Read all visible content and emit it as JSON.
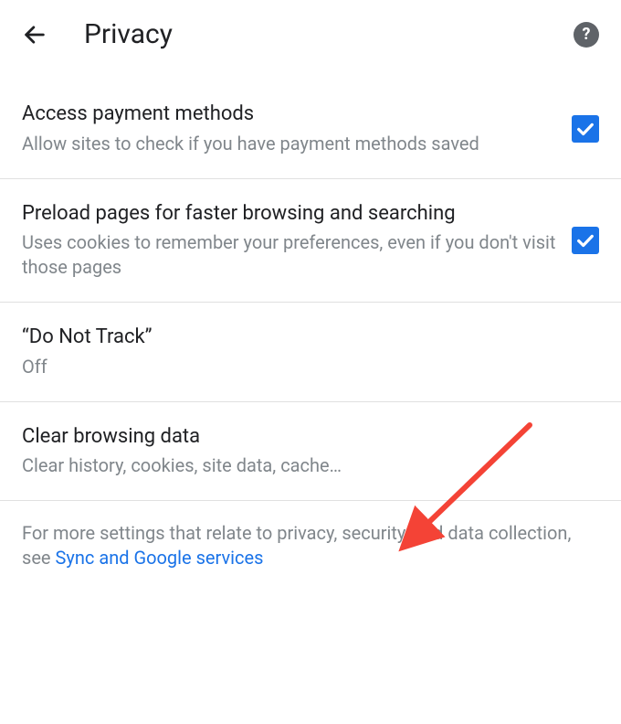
{
  "header": {
    "title": "Privacy"
  },
  "settings": {
    "payment": {
      "title": "Access payment methods",
      "desc": "Allow sites to check if you have payment methods saved"
    },
    "preload": {
      "title": "Preload pages for faster browsing and searching",
      "desc": "Uses cookies to remember your preferences, even if you don't visit those pages"
    },
    "dnt": {
      "title": "“Do Not Track”",
      "desc": "Off"
    },
    "clear": {
      "title": "Clear browsing data",
      "desc": "Clear history, cookies, site data, cache…"
    }
  },
  "footer": {
    "prefix": "For more settings that relate to privacy, security, and data collection, see ",
    "link": "Sync and Google services"
  },
  "colors": {
    "accent": "#1a73e8",
    "arrow": "#f44336"
  }
}
